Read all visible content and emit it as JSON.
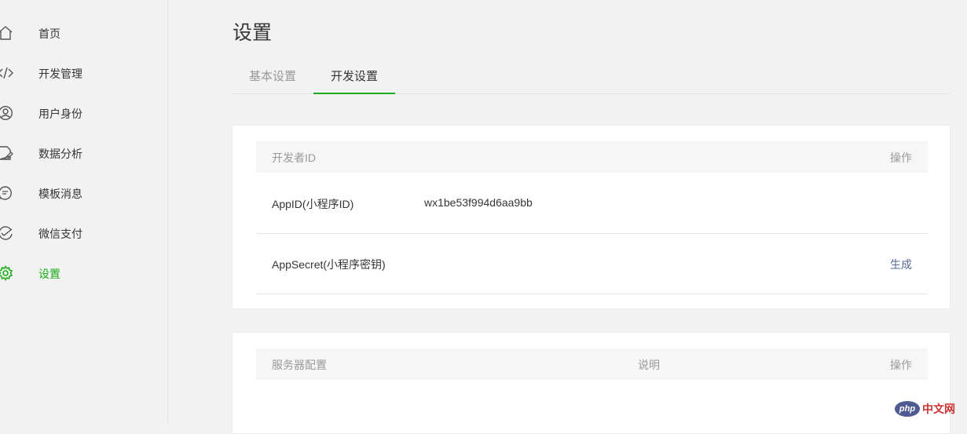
{
  "sidebar": {
    "items": [
      {
        "label": "首页",
        "icon": "home-icon"
      },
      {
        "label": "开发管理",
        "icon": "code-icon"
      },
      {
        "label": "用户身份",
        "icon": "user-icon"
      },
      {
        "label": "数据分析",
        "icon": "data-analysis-icon"
      },
      {
        "label": "模板消息",
        "icon": "message-icon"
      },
      {
        "label": "微信支付",
        "icon": "payment-icon"
      },
      {
        "label": "设置",
        "icon": "gear-icon",
        "active": true
      }
    ]
  },
  "page": {
    "title": "设置"
  },
  "tabs": [
    {
      "label": "基本设置",
      "active": false
    },
    {
      "label": "开发设置",
      "active": true
    }
  ],
  "developer_card": {
    "header": {
      "col1": "开发者ID",
      "col2": "操作"
    },
    "rows": [
      {
        "label": "AppID(小程序ID)",
        "value": "wx1be53f994d6aa9bb",
        "action": ""
      },
      {
        "label": "AppSecret(小程序密钥)",
        "value": "",
        "action": "生成"
      }
    ]
  },
  "server_card": {
    "header": {
      "col1": "服务器配置",
      "col2": "说明",
      "col3": "操作"
    }
  },
  "watermark": {
    "logo": "php",
    "text": "中文网"
  },
  "colors": {
    "accent": "#1aad19",
    "link": "#576b95",
    "text": "#353535",
    "muted": "#9a9a9a"
  }
}
